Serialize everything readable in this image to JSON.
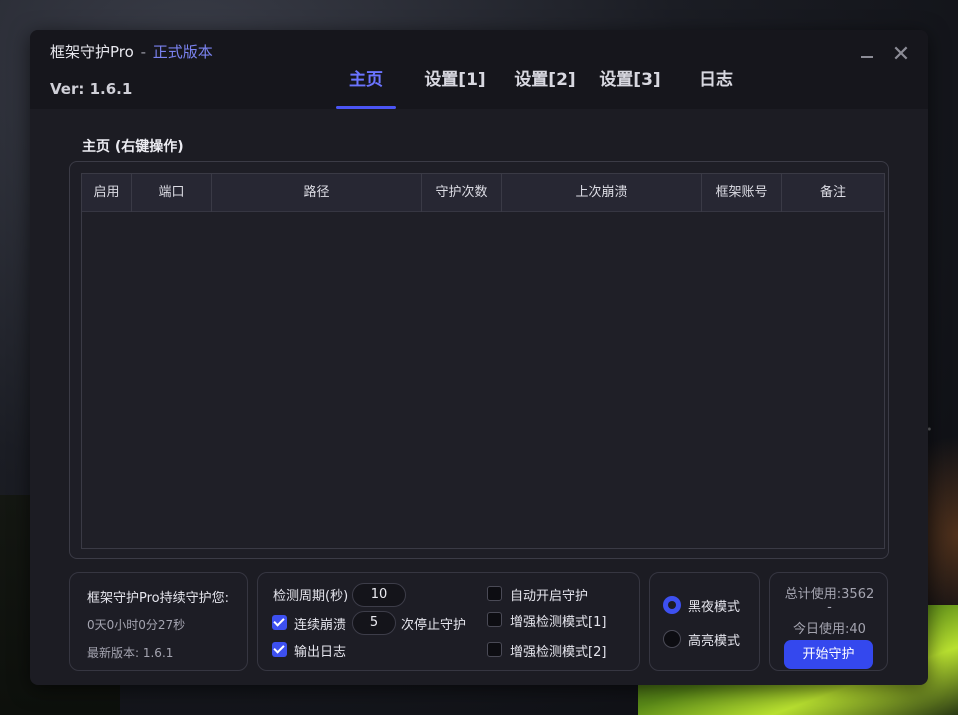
{
  "app": {
    "title": "框架守护Pro",
    "title_sep": "-",
    "edition": "正式版本",
    "version_prefix": "Ver:",
    "version": "1.6.1"
  },
  "tabs": [
    {
      "label": "主页",
      "active": true
    },
    {
      "label": "设置[1]",
      "active": false
    },
    {
      "label": "设置[2]",
      "active": false
    },
    {
      "label": "设置[3]",
      "active": false
    },
    {
      "label": "日志",
      "active": false
    }
  ],
  "window_controls": {
    "minimize": "minimize-icon",
    "close_glyph": "✕"
  },
  "main": {
    "section_title": "主页 (右键操作)",
    "table": {
      "columns": [
        "启用",
        "端口",
        "路径",
        "守护次数",
        "上次崩溃",
        "框架账号",
        "备注"
      ],
      "rows": []
    }
  },
  "status_panel": {
    "line1": "框架守护Pro持续守护您:",
    "uptime": "0天0小时0分27秒",
    "latest_version": "最新版本: 1.6.1"
  },
  "settings_panel": {
    "interval_label": "检测周期(秒)",
    "interval_value": "10",
    "crash_label": "连续崩溃",
    "crash_checked": true,
    "crash_value": "5",
    "crash_suffix": "次停止守护",
    "log_label": "输出日志",
    "log_checked": true,
    "auto_start_label": "自动开启守护",
    "auto_start_checked": false,
    "enhanced1_label": "增强检测模式[1]",
    "enhanced1_checked": false,
    "enhanced2_label": "增强检测模式[2]",
    "enhanced2_checked": false
  },
  "theme_panel": {
    "dark_label": "黑夜模式",
    "dark_selected": true,
    "light_label": "高亮模式",
    "light_selected": false
  },
  "usage_panel": {
    "total": "总计使用:3562",
    "separator": "-",
    "today": "今日使用:40",
    "start_button": "开始守护"
  },
  "colors": {
    "accent": "#3448ee",
    "accent_text": "#6b74ff",
    "edition_text": "#7a82f0",
    "window_bg": "#1c1c23",
    "titlebar_bg": "#16161c"
  }
}
